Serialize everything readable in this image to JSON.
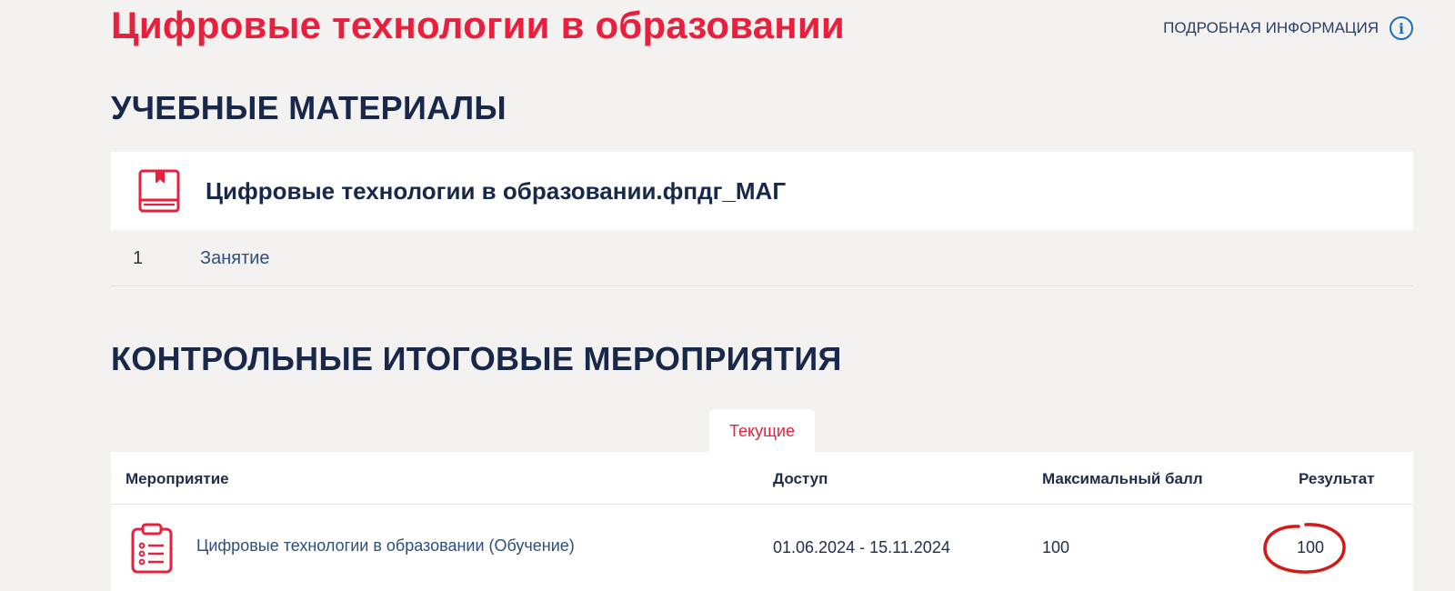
{
  "course": {
    "title": "Цифровые технологии в образовании",
    "info_link": "ПОДРОБНАЯ ИНФОРМАЦИЯ",
    "info_icon": "info-circle-icon"
  },
  "materials": {
    "heading": "УЧЕБНЫЕ МАТЕРИАЛЫ",
    "card_icon": "book-icon",
    "card_title": "Цифровые технологии в образовании.фпдг_МАГ",
    "lessons": [
      {
        "number": "1",
        "label": "Занятие"
      }
    ]
  },
  "control": {
    "heading": "КОНТРОЛЬНЫЕ ИТОГОВЫЕ МЕРОПРИЯТИЯ",
    "tab_current": "Текущие",
    "columns": {
      "event": "Мероприятие",
      "access": "Доступ",
      "max_score": "Максимальный балл",
      "result": "Результат"
    },
    "rows": [
      {
        "icon": "clipboard-list-icon",
        "event": "Цифровые технологии в образовании (Обучение)",
        "access": "01.06.2024 - 15.11.2024",
        "max_score": "100",
        "result": "100"
      }
    ]
  },
  "colors": {
    "accent": "#e8203d",
    "heading": "#17284a",
    "link": "#2c4f7c",
    "info_icon": "#1f6fb8",
    "annotation": "#d11a1a",
    "background": "#f3f2f0"
  }
}
